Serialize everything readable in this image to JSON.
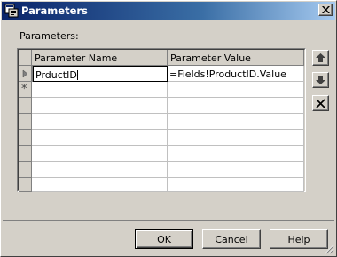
{
  "window": {
    "title": "Parameters",
    "icon": "parameters-app-icon",
    "close_icon": "close-icon"
  },
  "main": {
    "label": "Parameters:",
    "grid": {
      "columns": [
        "Parameter Name",
        "Parameter Value"
      ],
      "rows": [
        {
          "name": "PrductID",
          "value": "=Fields!ProductID.Value",
          "editing": true
        }
      ],
      "new_row_marker": "*"
    },
    "side_buttons": {
      "move_up": "arrow-up-icon",
      "move_down": "arrow-down-icon",
      "delete": "delete-x-icon"
    }
  },
  "footer": {
    "ok_label": "OK",
    "cancel_label": "Cancel",
    "help_label": "Help"
  }
}
